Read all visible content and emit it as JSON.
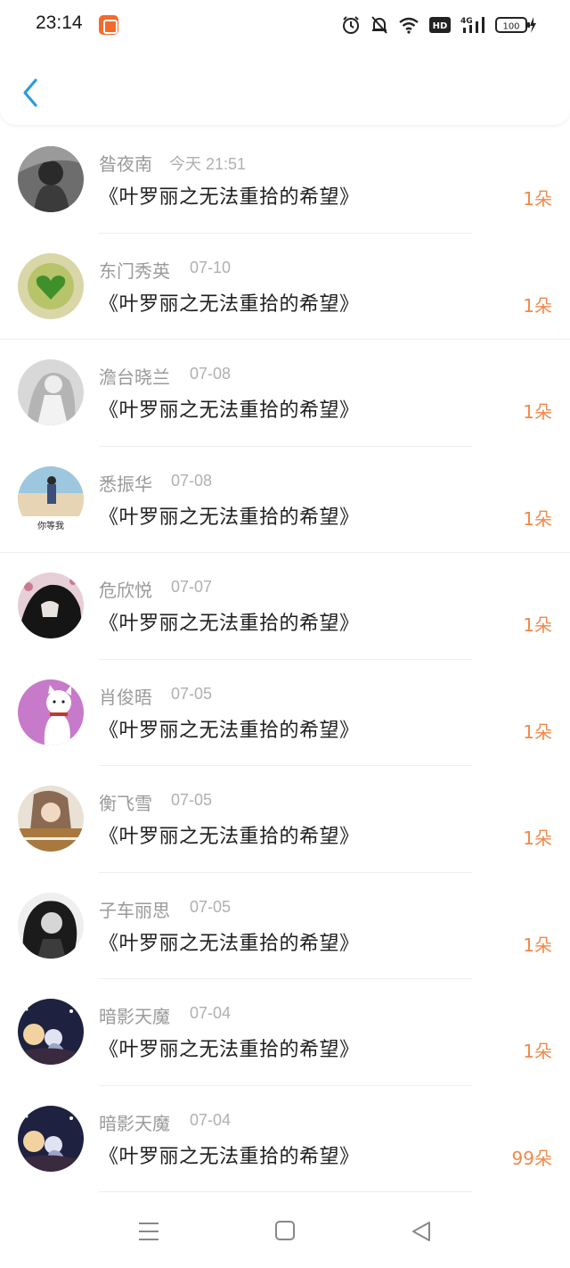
{
  "status": {
    "time": "23:14",
    "network": "4G",
    "quality": "HD",
    "battery": "100"
  },
  "colors": {
    "accent": "#2b9be3",
    "count": "#f0894a",
    "app_badge": "#f26b2c"
  },
  "header": {
    "back_icon": "chevron-left-icon"
  },
  "list": [
    {
      "name": "昝夜南",
      "time": "今天 21:51",
      "book": "《叶罗丽之无法重拾的希望》",
      "count": "1朵"
    },
    {
      "name": "东门秀英",
      "time": "07-10",
      "book": "《叶罗丽之无法重拾的希望》",
      "count": "1朵"
    },
    {
      "name": "澹台晓兰",
      "time": "07-08",
      "book": "《叶罗丽之无法重拾的希望》",
      "count": "1朵"
    },
    {
      "name": "悉振华",
      "time": "07-08",
      "book": "《叶罗丽之无法重拾的希望》",
      "count": "1朵",
      "avatar_caption": "你等我"
    },
    {
      "name": "危欣悦",
      "time": "07-07",
      "book": "《叶罗丽之无法重拾的希望》",
      "count": "1朵"
    },
    {
      "name": "肖俊晤",
      "time": "07-05",
      "book": "《叶罗丽之无法重拾的希望》",
      "count": "1朵"
    },
    {
      "name": "衡飞雪",
      "time": "07-05",
      "book": "《叶罗丽之无法重拾的希望》",
      "count": "1朵"
    },
    {
      "name": "子车丽思",
      "time": "07-05",
      "book": "《叶罗丽之无法重拾的希望》",
      "count": "1朵"
    },
    {
      "name": "暗影天魔",
      "time": "07-04",
      "book": "《叶罗丽之无法重拾的希望》",
      "count": "1朵"
    },
    {
      "name": "暗影天魔",
      "time": "07-04",
      "book": "《叶罗丽之无法重拾的希望》",
      "count": "99朵"
    }
  ],
  "nav": {
    "menu_icon": "menu-icon",
    "home_icon": "home-square-icon",
    "back_icon": "back-triangle-icon"
  }
}
